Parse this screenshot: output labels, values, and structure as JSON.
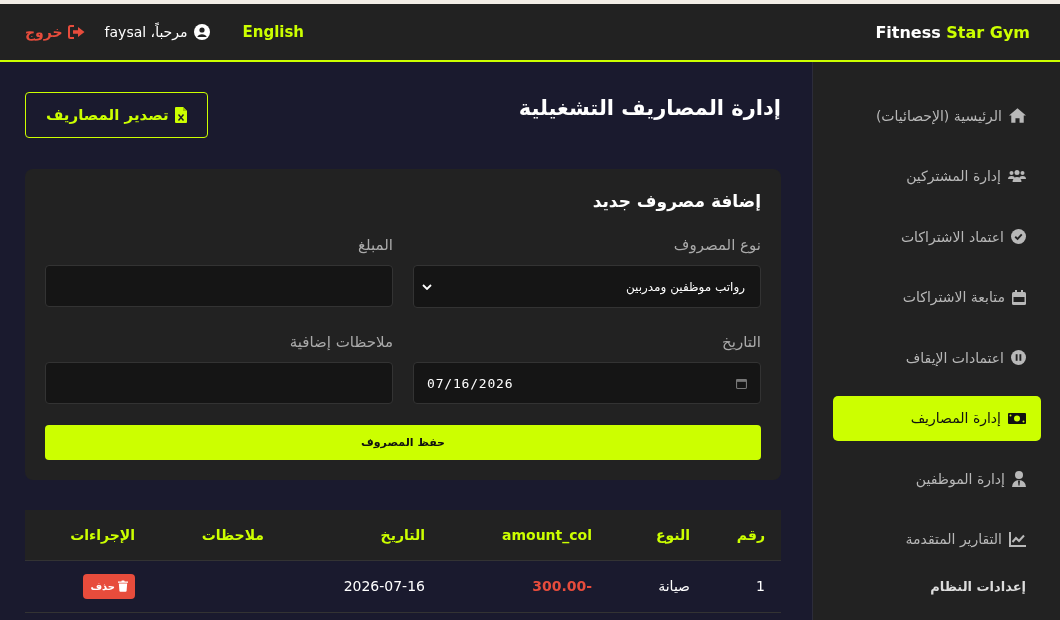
{
  "header": {
    "brand": {
      "name": "Fitness",
      "accent": "Star Gym"
    },
    "language_link": "English",
    "greeting": "مرحباً، faysal",
    "logout": "خروج"
  },
  "sidebar": {
    "items": [
      {
        "label": "الرئيسية (الإحصائيات)",
        "selected": false
      },
      {
        "label": "إدارة المشتركين",
        "selected": false
      },
      {
        "label": "اعتماد الاشتراكات",
        "selected": false
      },
      {
        "label": "متابعة الاشتراكات",
        "selected": false
      },
      {
        "label": "اعتمادات الإيقاف",
        "selected": false
      },
      {
        "label": "إدارة المصاريف",
        "selected": true
      },
      {
        "label": "إدارة الموظفين",
        "selected": false
      },
      {
        "label": "التقارير المتقدمة",
        "selected": false
      }
    ],
    "section_title": "إعدادات النظام"
  },
  "page": {
    "title": "إدارة المصاريف التشغيلية",
    "export_button": "تصدير المصاريف"
  },
  "form": {
    "title": "إضافة مصروف جديد",
    "fields": [
      {
        "kind": "select",
        "label": "نوع المصروف",
        "value": "رواتب موظفين ومدربين"
      },
      {
        "kind": "text",
        "label": "المبلغ"
      },
      {
        "kind": "date",
        "label": "التاريخ",
        "value": "07/16/2026"
      },
      {
        "kind": "text",
        "label": "ملاحظات إضافية"
      }
    ],
    "submit_button": "حفظ المصروف"
  },
  "table": {
    "columns": [
      "رقم",
      "النوع",
      "amount_col",
      "التاريخ",
      "ملاحظات",
      "الإجراءات"
    ],
    "rows": [
      {
        "number": "1",
        "type": "صيانة",
        "amount": "-300.00",
        "date": "2026-07-16",
        "delete_button": "حذف"
      }
    ]
  }
}
